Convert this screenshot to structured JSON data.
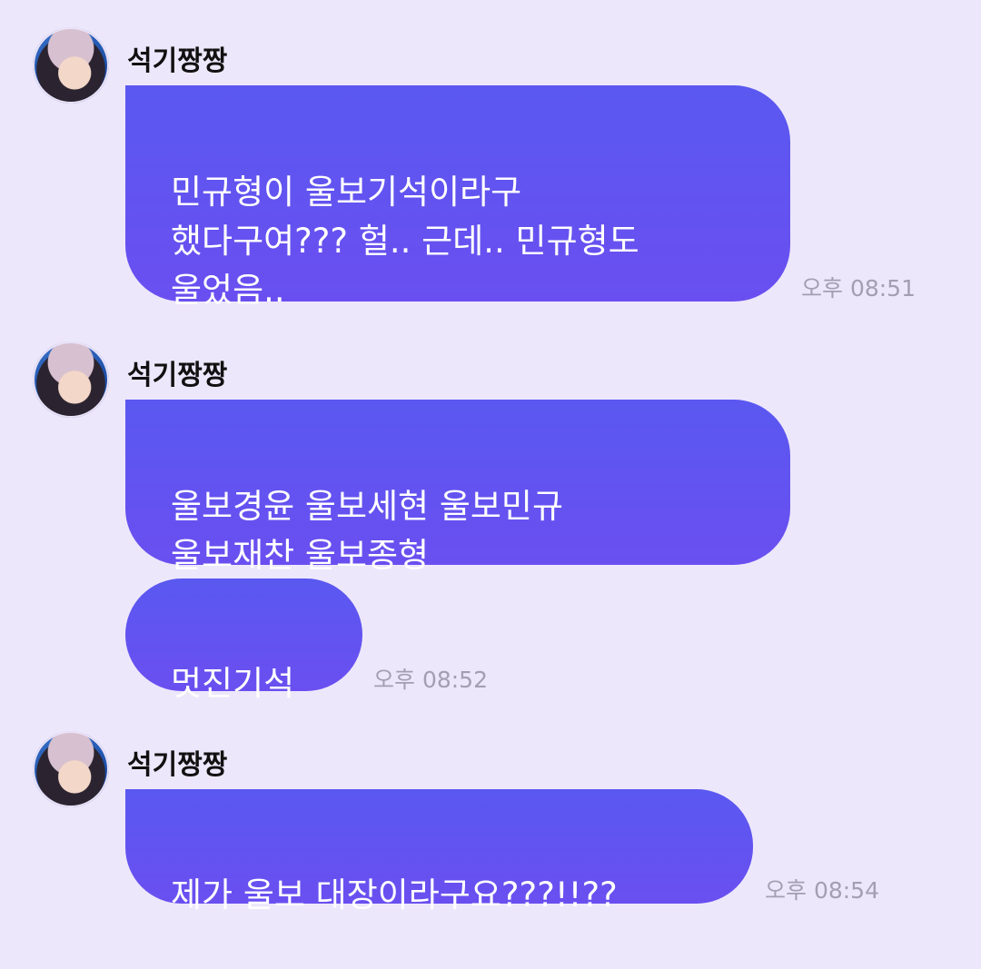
{
  "chat": {
    "messages": [
      {
        "sender": "석기짱짱",
        "bubbles": [
          {
            "text": "민규형이 울보기석이라구\n했다구여??? 헐.. 근데.. 민규형도\n울었음.."
          }
        ],
        "time": "오후 08:51"
      },
      {
        "sender": "석기짱짱",
        "bubbles": [
          {
            "text": "울보경윤 울보세현 울보민규\n울보재찬 울보종형"
          },
          {
            "text": "멋진기석"
          }
        ],
        "time": "오후 08:52"
      },
      {
        "sender": "석기짱짱",
        "bubbles": [
          {
            "text": "제가 울보 대장이라구요???!!??"
          }
        ],
        "time": "오후 08:54"
      }
    ]
  },
  "colors": {
    "background": "#ede7fb",
    "bubble_top": "#5a58f0",
    "bubble_bottom": "#6a4ff0",
    "timestamp": "#a39fb3"
  },
  "icons": {
    "avatar": "profile-photo"
  }
}
